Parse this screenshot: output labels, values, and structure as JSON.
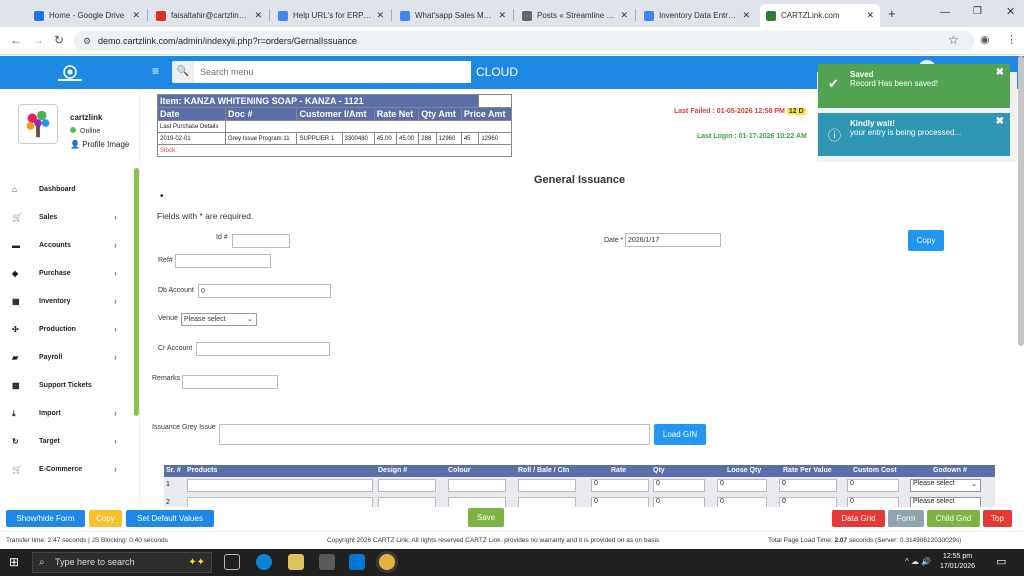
{
  "browser": {
    "tabs": [
      {
        "label": "Home - Google Drive",
        "color": "#1a73e8"
      },
      {
        "label": "faisaltahir@cartzlink.cc",
        "color": "#d93025"
      },
      {
        "label": "Help URL's for ERP Sys",
        "color": "#4285f4"
      },
      {
        "label": "What'sapp Sales Mess",
        "color": "#4285f4"
      },
      {
        "label": "Posts « Streamline Syst",
        "color": "#666666"
      },
      {
        "label": "Inventory Data Entry M",
        "color": "#4285f4"
      },
      {
        "label": "CARTZLink.com",
        "color": "#2e7d32"
      }
    ],
    "url": "demo.cartzlink.com/admin/indexyii.php?r=orders/GernalIssuance"
  },
  "header": {
    "search_placeholder": "Search menu",
    "cloud_label": "CLOUD"
  },
  "user": {
    "name": "cartzlink",
    "status": "Online",
    "profile": "Profile Image"
  },
  "sidebar": {
    "items": [
      {
        "label": "Dashboard",
        "icon": "⌂",
        "chevron": false
      },
      {
        "label": "Sales",
        "icon": "🛒",
        "chevron": true
      },
      {
        "label": "Accounts",
        "icon": "▬",
        "chevron": true
      },
      {
        "label": "Purchase",
        "icon": "◆",
        "chevron": true
      },
      {
        "label": "Inventory",
        "icon": "▦",
        "chevron": true
      },
      {
        "label": "Production",
        "icon": "✣",
        "chevron": true
      },
      {
        "label": "Payroll",
        "icon": "▰",
        "chevron": true
      },
      {
        "label": "Support Tickets",
        "icon": "▩",
        "chevron": false
      },
      {
        "label": "Import",
        "icon": "⤓",
        "chevron": true
      },
      {
        "label": "Target",
        "icon": "↻",
        "chevron": true
      },
      {
        "label": "E-Commerce",
        "icon": "🛒",
        "chevron": true
      }
    ]
  },
  "item_info": {
    "title": "Item: KANZA WHITENING SOAP - KANZA - 1121",
    "headers": [
      "Date",
      "Doc #",
      "Customer I/Amt",
      "Rate Net",
      "Qty Amt",
      "Price Amt"
    ],
    "last_purchase_label": "Last Purchase Details",
    "row": [
      "2019-02-01",
      "Grey Issue Program 11",
      "SUPPLIER 1",
      "3300480",
      "45.00",
      "45.00",
      "288",
      "12960",
      "45",
      "12960"
    ],
    "stock_label": "Stock :"
  },
  "login_info": {
    "last_failed": "Last Failed : 01-05-2026 12:58 PM",
    "last_failed_badge": "12 D",
    "last_login": "Last Login : 01-17-2026 10:22 AM"
  },
  "toasts": [
    {
      "title": "Saved",
      "message": "Record Has been saved!"
    },
    {
      "title": "Kindly wait!",
      "message": "your entry is being processed..."
    }
  ],
  "form": {
    "title": "General Issuance",
    "bullet": "•",
    "required_note": "Fields with * are required.",
    "id_label": "Id #",
    "id_value": "",
    "date_label": "Date *",
    "date_value": "2026/1/17",
    "copy_label": "Copy",
    "ref_label": "Ref#",
    "ref_value": "",
    "db_account_label": "Db Account",
    "db_account_value": "0",
    "venue_label": "Venue",
    "venue_value": "Please select",
    "cr_account_label": "Cr Account",
    "cr_account_value": "",
    "remarks_label": "Remarks",
    "remarks_value": "",
    "grey_issue_label": "Issuance Grey Issue",
    "grey_issue_value": "",
    "load_gin_label": "Load GIN"
  },
  "grid": {
    "headers": [
      "Sr. #",
      "Products",
      "Design #",
      "Colour",
      "Roll / Bale / Ctn",
      "Rate",
      "Qty",
      "Loose Qty",
      "Rate Per Value",
      "Custom Cost",
      "Godown #"
    ],
    "rows": [
      {
        "sr": "1",
        "rate": "0",
        "qty": "0",
        "loose": "0",
        "rpv": "0",
        "cost": "0",
        "godown": "Please select"
      },
      {
        "sr": "2",
        "rate": "0",
        "qty": "0",
        "loose": "0",
        "rpv": "0",
        "cost": "0",
        "godown": "Please select"
      }
    ]
  },
  "toolbar": {
    "show_hide": "Show/hide Form",
    "copy": "Copy",
    "set_default": "Set Default Values",
    "save": "Save",
    "data_grid": "Data Grid",
    "form": "Form",
    "child_grid": "Child Grid",
    "top": "Top"
  },
  "footer": {
    "transfer": "Transfer time: 2.47 seconds | JS Blocking: 0.40 seconds",
    "copyright": "Copyright 2026 CARTZ Link. All rights reserved CARTZ Link. provides no warranty and it is provided on as on basis",
    "load_time_prefix": "Total Page Load Time:",
    "load_time_value": "2.07",
    "load_time_suffix": "seconds (Server: 0.31490612030029s)"
  },
  "taskbar": {
    "search": "Type here to search",
    "time": "12:55 pm",
    "date": "17/01/2026"
  }
}
